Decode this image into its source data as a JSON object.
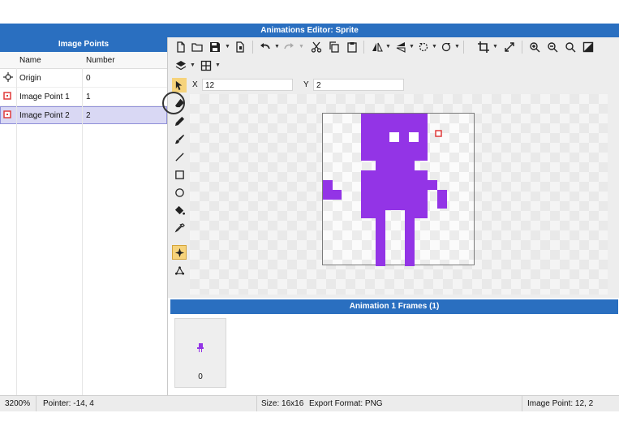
{
  "window": {
    "title": "Animations Editor: Sprite"
  },
  "image_points_panel": {
    "title": "Image Points",
    "columns": {
      "name": "Name",
      "number": "Number"
    },
    "rows": [
      {
        "name": "Origin",
        "number": "0",
        "icon": "origin-crosshair-icon",
        "selected": false
      },
      {
        "name": "Image Point 1",
        "number": "1",
        "icon": "image-point-icon",
        "selected": false
      },
      {
        "name": "Image Point 2",
        "number": "2",
        "icon": "image-point-icon",
        "selected": true
      }
    ]
  },
  "coords": {
    "x_label": "X",
    "x_value": "12",
    "y_label": "Y",
    "y_value": "2"
  },
  "toolbar_icons": [
    "new-file-icon",
    "open-folder-icon",
    "save-icon",
    "export-icon",
    "undo-icon",
    "redo-icon",
    "cut-icon",
    "copy-icon",
    "paste-icon",
    "flip-icon",
    "mirror-icon",
    "rotate-left-icon",
    "rotate-right-icon",
    "crop-icon",
    "resize-icon",
    "zoom-in-icon",
    "zoom-out-icon",
    "zoom-reset-icon",
    "toggle-background-icon",
    "layers-icon",
    "grid-icon"
  ],
  "tools": [
    "select-tool-icon",
    "eraser-icon",
    "pencil-icon",
    "brush-icon",
    "line-icon",
    "rectangle-icon",
    "ellipse-icon",
    "fill-bucket-icon",
    "eyedropper-icon",
    "image-point-tool-icon",
    "origin-tool-icon"
  ],
  "active_tool": "image-point-tool-icon",
  "colors": {
    "accent_blue": "#2a6fc0",
    "sprite_purple": "#9334e6",
    "image_point_red": "#e03a3a",
    "selection_row": "#d9d8f4",
    "active_tool": "#f6d37b"
  },
  "frames_panel": {
    "title": "Animation 1 Frames (1)",
    "frames": [
      {
        "number": "0"
      }
    ]
  },
  "status_bar": {
    "zoom": "3200%",
    "pointer": "Pointer: -14, 4",
    "size": "Size: 16x16",
    "export_format": "Export Format: PNG",
    "image_point": "Image Point: 12, 2"
  }
}
